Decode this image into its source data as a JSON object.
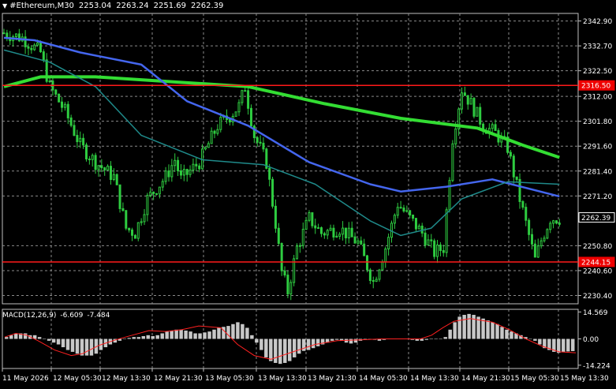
{
  "header": {
    "symbol": "#Ethereum,M30",
    "open": "2253.04",
    "high": "2263.24",
    "low": "2251.69",
    "close": "2262.39"
  },
  "macd": {
    "label": "MACD(12,26,9)",
    "main_value": "-6.609",
    "signal_value": "-7.484",
    "axis_labels": [
      "14.569",
      "0.00",
      "-14.224"
    ],
    "range": [
      -16,
      16
    ]
  },
  "price_axis": {
    "labels": [
      "2342.90",
      "2332.70",
      "2322.50",
      "2312.00",
      "2301.80",
      "2291.60",
      "2281.40",
      "2271.20",
      "2250.80",
      "2240.60",
      "2230.40"
    ],
    "range": [
      2227,
      2346
    ]
  },
  "price_tags": {
    "resistance": "2316.50",
    "current": "2262.39",
    "support": "2244.15"
  },
  "time_axis": {
    "labels": [
      "11 May 2026",
      "12 May 05:30",
      "12 May 13:30",
      "12 May 21:30",
      "13 May 05:30",
      "13 May 13:30",
      "13 May 21:30",
      "14 May 05:30",
      "14 May 13:30",
      "14 May 21:30",
      "15 May 05:30",
      "15 May 13:30"
    ]
  },
  "colors": {
    "background": "#000000",
    "candle": "#2ecc40",
    "grid": "#8a8a8a",
    "ma_slow": "#33dd33",
    "ma_mid": "#4466ee",
    "ma_fast": "#1f8a8a",
    "hline": "#ff1a1a",
    "tag_red": "#ee0000",
    "histogram": "#c8c8c8",
    "signal": "#ff2020"
  },
  "chart_data": {
    "type": "candlestick",
    "symbol": "#Ethereum",
    "timeframe": "M30",
    "ylim": [
      2227,
      2346
    ],
    "horizontal_lines": [
      2316.5,
      2244.15
    ],
    "current_price": 2262.39,
    "close_path": [
      [
        0,
        2338
      ],
      [
        6,
        2336
      ],
      [
        12,
        2330
      ],
      [
        15,
        2316
      ],
      [
        20,
        2306
      ],
      [
        25,
        2292
      ],
      [
        30,
        2285
      ],
      [
        36,
        2279
      ],
      [
        40,
        2258
      ],
      [
        43,
        2256
      ],
      [
        47,
        2270
      ],
      [
        53,
        2279
      ],
      [
        56,
        2286
      ],
      [
        58,
        2278
      ],
      [
        64,
        2285
      ],
      [
        70,
        2300
      ],
      [
        74,
        2304
      ],
      [
        77,
        2308
      ],
      [
        79,
        2316
      ],
      [
        82,
        2296
      ],
      [
        86,
        2285
      ],
      [
        89,
        2260
      ],
      [
        91,
        2240
      ],
      [
        93,
        2232
      ],
      [
        96,
        2250
      ],
      [
        100,
        2262
      ],
      [
        104,
        2256
      ],
      [
        110,
        2258
      ],
      [
        116,
        2252
      ],
      [
        121,
        2236
      ],
      [
        125,
        2250
      ],
      [
        129,
        2268
      ],
      [
        133,
        2262
      ],
      [
        137,
        2256
      ],
      [
        141,
        2248
      ],
      [
        144,
        2250
      ],
      [
        147,
        2295
      ],
      [
        150,
        2315
      ],
      [
        153,
        2309
      ],
      [
        157,
        2300
      ],
      [
        161,
        2297
      ],
      [
        165,
        2291
      ],
      [
        169,
        2270
      ],
      [
        172,
        2255
      ],
      [
        174,
        2245
      ],
      [
        176,
        2253
      ],
      [
        179,
        2262
      ],
      [
        182,
        2262
      ]
    ],
    "moving_averages": [
      {
        "name": "slow",
        "color": "#33dd33",
        "points": [
          [
            0,
            2316
          ],
          [
            12,
            2320
          ],
          [
            30,
            2320
          ],
          [
            55,
            2318
          ],
          [
            80,
            2316
          ],
          [
            105,
            2309
          ],
          [
            130,
            2303
          ],
          [
            155,
            2299
          ],
          [
            170,
            2292
          ],
          [
            182,
            2287
          ]
        ]
      },
      {
        "name": "mid",
        "color": "#4466ee",
        "points": [
          [
            0,
            2336
          ],
          [
            10,
            2335
          ],
          [
            25,
            2330
          ],
          [
            45,
            2325
          ],
          [
            60,
            2310
          ],
          [
            80,
            2300
          ],
          [
            100,
            2285
          ],
          [
            120,
            2276
          ],
          [
            130,
            2273
          ],
          [
            145,
            2275
          ],
          [
            160,
            2278
          ],
          [
            182,
            2271
          ]
        ]
      },
      {
        "name": "fast",
        "color": "#1f8a8a",
        "points": [
          [
            0,
            2331
          ],
          [
            15,
            2326
          ],
          [
            30,
            2316
          ],
          [
            45,
            2296
          ],
          [
            65,
            2286
          ],
          [
            85,
            2284
          ],
          [
            102,
            2276
          ],
          [
            120,
            2261
          ],
          [
            130,
            2255
          ],
          [
            140,
            2258
          ],
          [
            150,
            2270
          ],
          [
            165,
            2277
          ],
          [
            182,
            2276
          ]
        ]
      }
    ],
    "macd_histogram": [
      1.0,
      2.0,
      3.0,
      3.0,
      3.0,
      2.0,
      2.0,
      1.0,
      0.0,
      -1.0,
      -2.0,
      -3.0,
      -4.5,
      -6.0,
      -7.0,
      -8.0,
      -9.0,
      -9.0,
      -9.0,
      -8.0,
      -6.0,
      -4.5,
      -3.0,
      -2.0,
      -1.0,
      0.0,
      0.5,
      1.0,
      1.0,
      1.5,
      2.0,
      1.5,
      2.0,
      3.0,
      4.0,
      4.5,
      5.0,
      5.0,
      4.5,
      4.0,
      3.0,
      3.0,
      3.5,
      4.0,
      5.0,
      6.0,
      6.5,
      7.0,
      8.0,
      9.0,
      8.0,
      6.0,
      2.0,
      -2.0,
      -6.0,
      -10.0,
      -12.0,
      -13.0,
      -13.5,
      -13.0,
      -12.0,
      -10.0,
      -8.0,
      -6.5,
      -6.0,
      -5.0,
      -4.0,
      -3.0,
      -2.0,
      -1.0,
      -0.5,
      -1.0,
      -2.0,
      -2.5,
      -2.0,
      -1.0,
      -0.5,
      0.0,
      -0.5,
      -1.0,
      -0.5,
      0.0,
      0.0,
      0.0,
      0.0,
      0.0,
      -0.5,
      -1.0,
      -1.0,
      -0.5,
      0.0,
      0.0,
      0.0,
      1.0,
      5.0,
      9.0,
      12.0,
      13.0,
      13.5,
      13.0,
      12.0,
      11.0,
      10.0,
      9.0,
      8.0,
      6.5,
      5.0,
      4.0,
      3.0,
      2.0,
      1.0,
      0.0,
      -1.0,
      -3.0,
      -5.0,
      -6.0,
      -7.0,
      -7.5,
      -7.0,
      -6.8,
      -6.6
    ],
    "macd_signal": [
      [
        0,
        1.0
      ],
      [
        10,
        3.0
      ],
      [
        20,
        2.0
      ],
      [
        30,
        -1.0
      ],
      [
        45,
        -6.0
      ],
      [
        60,
        -9.0
      ],
      [
        70,
        -8.0
      ],
      [
        85,
        -3.5
      ],
      [
        100,
        -0.5
      ],
      [
        115,
        2.0
      ],
      [
        130,
        4.5
      ],
      [
        145,
        4.0
      ],
      [
        160,
        5.0
      ],
      [
        175,
        7.0
      ],
      [
        195,
        6.0
      ],
      [
        210,
        -3.0
      ],
      [
        225,
        -9.0
      ],
      [
        240,
        -11.0
      ],
      [
        260,
        -7.0
      ],
      [
        280,
        -3.0
      ],
      [
        300,
        -1.0
      ],
      [
        320,
        -0.5
      ],
      [
        340,
        0.0
      ],
      [
        360,
        0.0
      ],
      [
        375,
        0.0
      ],
      [
        385,
        2.0
      ],
      [
        395,
        6.0
      ],
      [
        405,
        9.5
      ],
      [
        420,
        11.0
      ],
      [
        440,
        9.0
      ],
      [
        455,
        5.0
      ],
      [
        470,
        0.0
      ],
      [
        485,
        -4.0
      ],
      [
        500,
        -7.0
      ],
      [
        515,
        -7.5
      ]
    ]
  }
}
